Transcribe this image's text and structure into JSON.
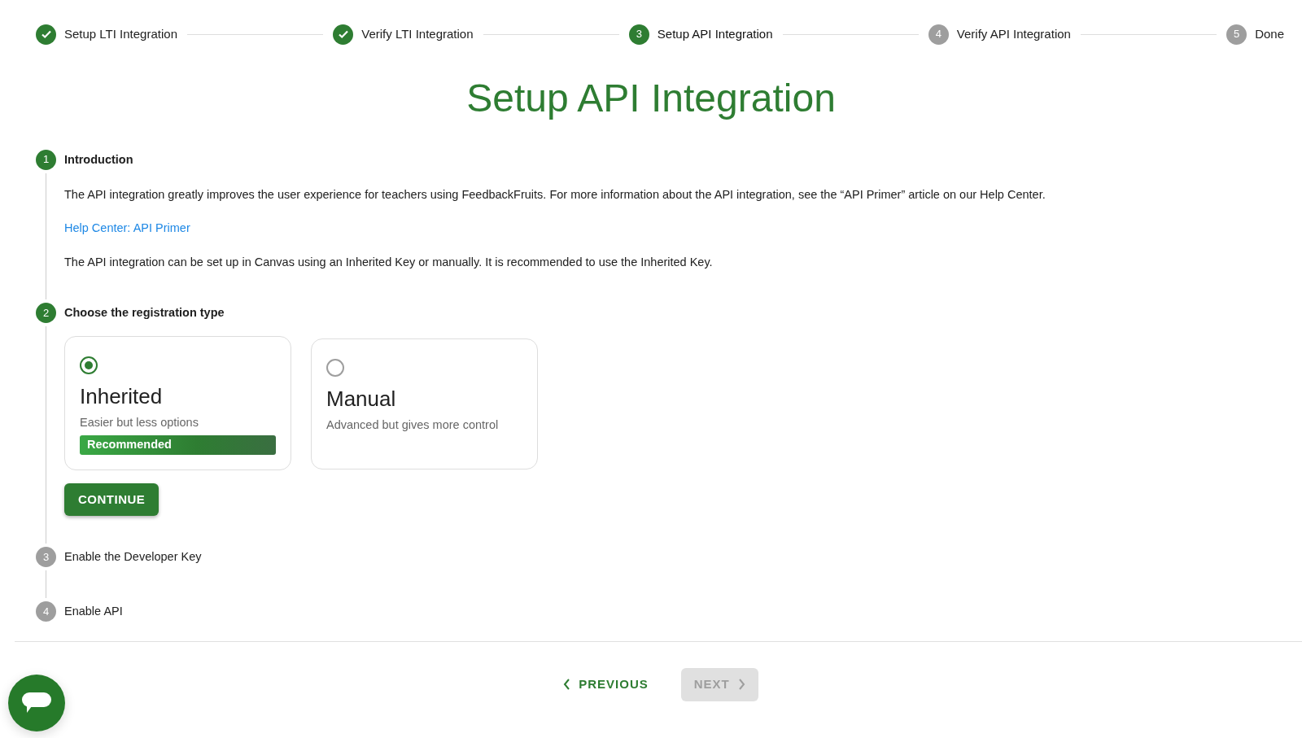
{
  "stepper": [
    {
      "label": "Setup LTI Integration",
      "completed": true
    },
    {
      "label": "Verify LTI Integration",
      "completed": true
    },
    {
      "number": "3",
      "label": "Setup API Integration",
      "completed": false,
      "current": true
    },
    {
      "number": "4",
      "label": "Verify API Integration",
      "completed": false,
      "current": false
    },
    {
      "number": "5",
      "label": "Done",
      "completed": false,
      "current": false
    }
  ],
  "title": "Setup API Integration",
  "sections": [
    {
      "number": "1",
      "title": "Introduction",
      "current": true,
      "content": [
        {
          "kind": "text",
          "text": "The API integration greatly improves the user experience for teachers using FeedbackFruits. For more information about the API integration, see the “API Primer” article on our Help Center."
        },
        {
          "kind": "link",
          "text": "Help Center: API Primer"
        },
        {
          "kind": "text",
          "text": "The API integration can be set up in Canvas using an Inherited Key or manually. It is recommended to use the Inherited Key."
        }
      ]
    },
    {
      "number": "2",
      "title": "Choose the registration type",
      "current": true,
      "options": [
        {
          "title": "Inherited",
          "subtitle": "Easier but less options",
          "badge": "Recommended",
          "selected": true
        },
        {
          "title": "Manual",
          "subtitle": "Advanced but gives more control",
          "selected": false
        }
      ],
      "button": "CONTINUE"
    },
    {
      "number": "3",
      "title": "Enable the Developer Key",
      "current": false
    },
    {
      "number": "4",
      "title": "Enable API",
      "current": false
    }
  ],
  "footer": {
    "previous": {
      "label": "PREVIOUS",
      "disabled": false
    },
    "next": {
      "label": "NEXT",
      "disabled": true
    }
  }
}
